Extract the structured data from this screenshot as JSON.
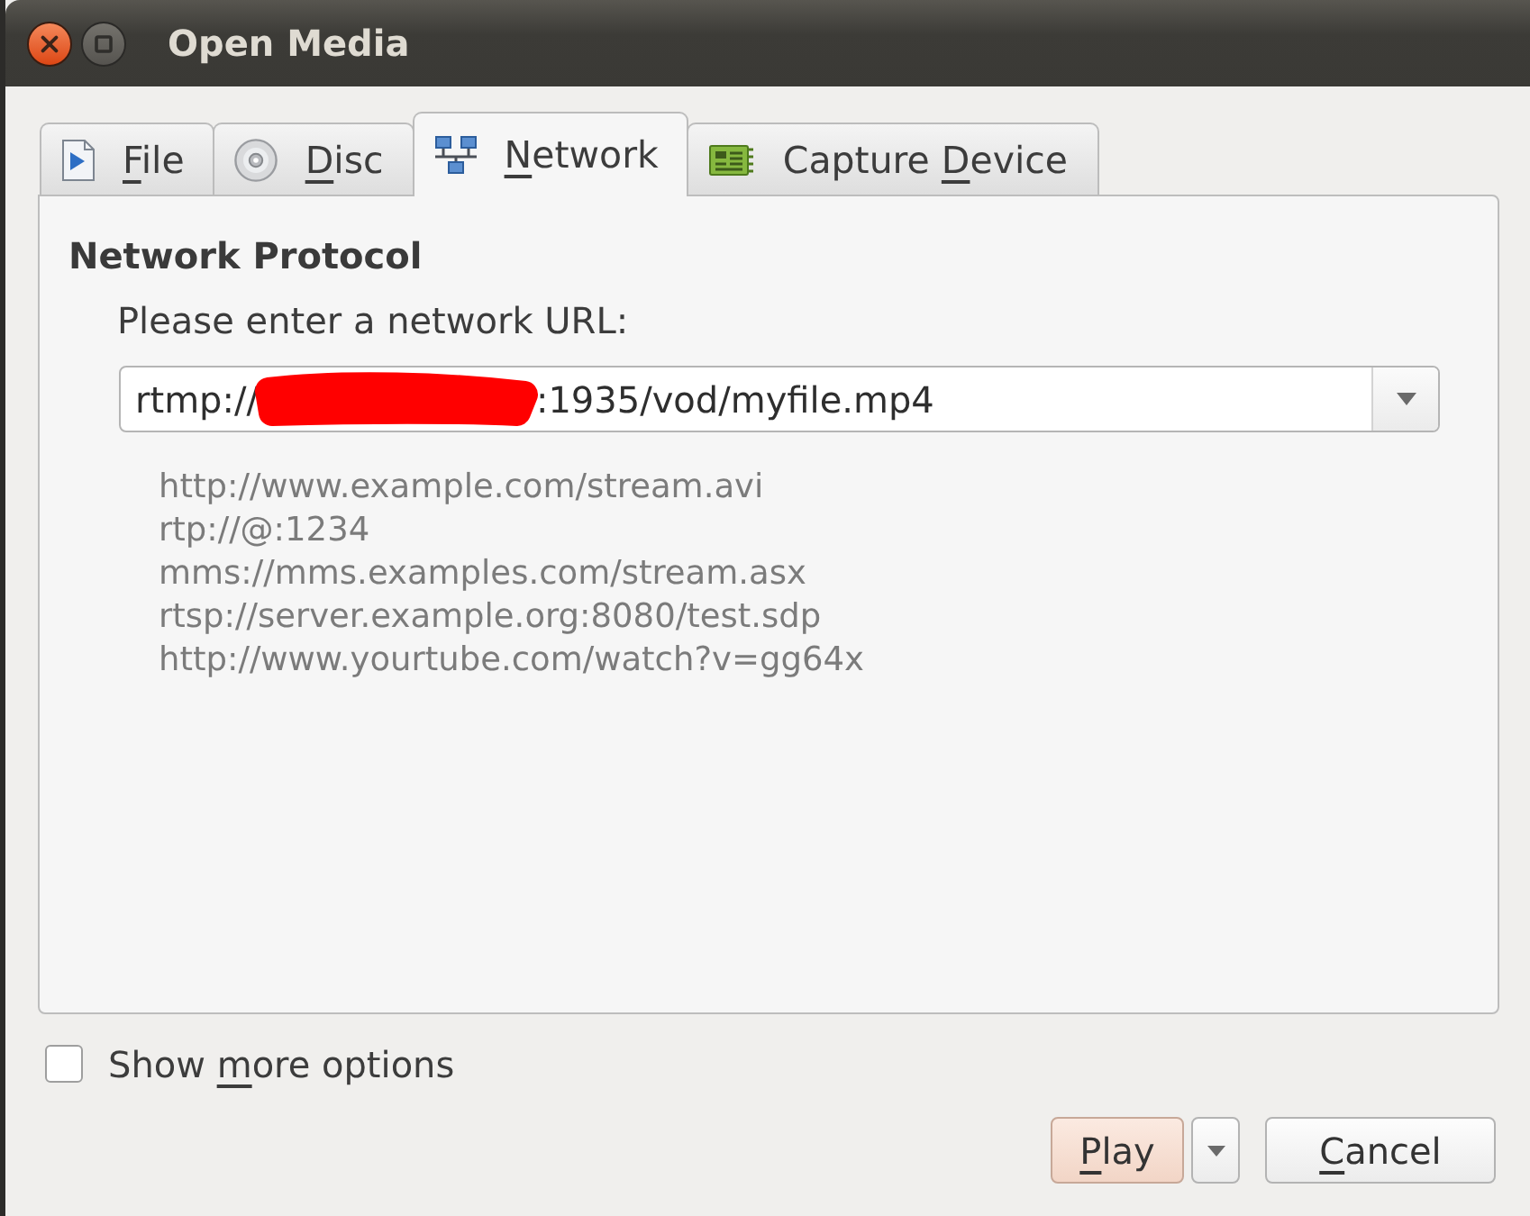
{
  "window": {
    "title": "Open Media"
  },
  "tabs": [
    {
      "access_key": "F",
      "text_after": "ile",
      "selected": false
    },
    {
      "access_key": "D",
      "text_after": "isc",
      "selected": false
    },
    {
      "access_key": "N",
      "text_after": "etwork",
      "selected": true
    },
    {
      "text_before": "Capture ",
      "access_key": "D",
      "text_after": "evice",
      "selected": false
    }
  ],
  "network_panel": {
    "heading": "Network Protocol",
    "prompt": "Please enter a network URL:",
    "url_field": {
      "value_before_redaction": "rtmp://",
      "redacted": true,
      "value_after_redaction": ":1935/vod/myfile.mp4"
    },
    "examples": [
      "http://www.example.com/stream.avi",
      "rtp://@:1234",
      "mms://mms.examples.com/stream.asx",
      "rtsp://server.example.org:8080/test.sdp",
      "http://www.yourtube.com/watch?v=gg64x"
    ]
  },
  "options_toggle": {
    "text_before": "Show ",
    "access_key": "m",
    "text_after": "ore options",
    "checked": false
  },
  "buttons": [
    {
      "access_key": "P",
      "text_after": "lay",
      "default": true,
      "kind": "split"
    },
    {
      "access_key": "C",
      "text_after": "ancel",
      "default": false,
      "kind": "plain"
    }
  ]
}
